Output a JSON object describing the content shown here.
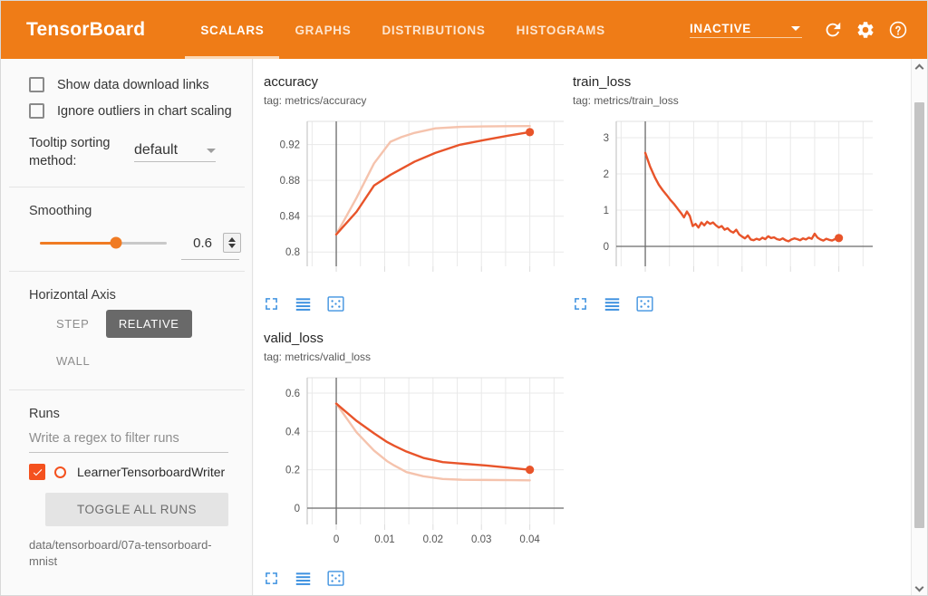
{
  "header": {
    "brand": "TensorBoard",
    "tabs": [
      {
        "label": "SCALARS",
        "active": true
      },
      {
        "label": "GRAPHS",
        "active": false
      },
      {
        "label": "DISTRIBUTIONS",
        "active": false
      },
      {
        "label": "HISTOGRAMS",
        "active": false
      }
    ],
    "status": "INACTIVE",
    "icons": [
      "reload-icon",
      "gear-icon",
      "help-icon"
    ],
    "accent_color": "#ef7c17"
  },
  "sidebar": {
    "checkboxes": [
      {
        "label": "Show data download links",
        "checked": false
      },
      {
        "label": "Ignore outliers in chart scaling",
        "checked": false
      }
    ],
    "tooltip_sorting": {
      "label": "Tooltip sorting method:",
      "value": "default"
    },
    "smoothing": {
      "title": "Smoothing",
      "value": "0.6",
      "fraction": 0.6
    },
    "horizontal_axis": {
      "title": "Horizontal Axis",
      "options": [
        {
          "label": "STEP",
          "selected": false
        },
        {
          "label": "RELATIVE",
          "selected": true
        },
        {
          "label": "WALL",
          "selected": false
        }
      ]
    },
    "runs": {
      "title": "Runs",
      "filter_placeholder": "Write a regex to filter runs",
      "items": [
        {
          "name": "LearnerTensorboardWriter",
          "checked": true,
          "color": "#f4511e"
        }
      ],
      "toggle_all_label": "TOGGLE ALL RUNS",
      "path": "data/tensorboard/07a-tensorboard-mnist"
    }
  },
  "charts": [
    {
      "title": "accuracy",
      "tag": "tag: metrics/accuracy",
      "toolbar": [
        "fullscreen-icon",
        "data-table-icon",
        "reset-zoom-icon"
      ]
    },
    {
      "title": "train_loss",
      "tag": "tag: metrics/train_loss",
      "toolbar": [
        "fullscreen-icon",
        "data-table-icon",
        "reset-zoom-icon"
      ]
    },
    {
      "title": "valid_loss",
      "tag": "tag: metrics/valid_loss",
      "toolbar": [
        "fullscreen-icon",
        "data-table-icon",
        "reset-zoom-icon"
      ]
    }
  ],
  "chart_data": [
    {
      "type": "line",
      "title": "accuracy",
      "tag": "metrics/accuracy",
      "xlabel": "",
      "ylabel": "",
      "xlim": [
        -0.006,
        0.047
      ],
      "ylim": [
        0.784,
        0.946
      ],
      "yticks": [
        0.8,
        0.84,
        0.88,
        0.92
      ],
      "ytick_labels": [
        "0.8",
        "0.84",
        "0.88",
        "0.92"
      ],
      "xticks": [
        0,
        0.01,
        0.02,
        0.03,
        0.04
      ],
      "xtick_labels": [
        "",
        "",
        "",
        "",
        ""
      ],
      "grid": true,
      "legend": "none",
      "series": [
        {
          "name": "LearnerTensorboardWriter (raw)",
          "color": "#f5c3ad",
          "x": [
            0,
            0.0042,
            0.0078,
            0.0112,
            0.0135,
            0.0162,
            0.0205,
            0.0255,
            0.0305,
            0.0355,
            0.04
          ],
          "y": [
            0.8196,
            0.8606,
            0.899,
            0.9232,
            0.9285,
            0.9332,
            0.9382,
            0.9398,
            0.9404,
            0.9406,
            0.9407
          ]
        },
        {
          "name": "LearnerTensorboardWriter (smoothed)",
          "color": "#e8542a",
          "x": [
            0,
            0.0042,
            0.0078,
            0.0112,
            0.0135,
            0.0162,
            0.0205,
            0.0255,
            0.0305,
            0.0355,
            0.04
          ],
          "y": [
            0.8196,
            0.845,
            0.8742,
            0.8862,
            0.893,
            0.901,
            0.9108,
            0.9198,
            0.925,
            0.93,
            0.934
          ]
        }
      ],
      "last_point": {
        "x": 0.04,
        "y": 0.934,
        "color": "#e8542a",
        "marker": "circle"
      }
    },
    {
      "type": "line",
      "title": "train_loss",
      "tag": "metrics/train_loss",
      "xlabel": "",
      "ylabel": "",
      "xlim": [
        -0.006,
        0.047
      ],
      "ylim": [
        -0.55,
        3.45
      ],
      "yticks": [
        0,
        1,
        2,
        3
      ],
      "ytick_labels": [
        "0",
        "1",
        "2",
        "3"
      ],
      "xticks": [
        0,
        0.01,
        0.02,
        0.03,
        0.04
      ],
      "xtick_labels": [
        "",
        "",
        "",
        "",
        ""
      ],
      "grid": true,
      "legend": "none",
      "series": [
        {
          "name": "LearnerTensorboardWriter (smoothed)",
          "color": "#e8542a",
          "x": [
            0.0,
            0.001,
            0.002,
            0.0028,
            0.0036,
            0.0044,
            0.0052,
            0.006,
            0.0068,
            0.0074,
            0.008,
            0.0086,
            0.0092,
            0.0098,
            0.0104,
            0.011,
            0.0116,
            0.0122,
            0.0128,
            0.0134,
            0.014,
            0.0146,
            0.0152,
            0.0158,
            0.0164,
            0.017,
            0.0176,
            0.0182,
            0.0188,
            0.0194,
            0.02,
            0.0206,
            0.0212,
            0.0218,
            0.0224,
            0.023,
            0.0236,
            0.0242,
            0.0248,
            0.0254,
            0.026,
            0.0266,
            0.0272,
            0.0278,
            0.0284,
            0.029,
            0.0296,
            0.0302,
            0.0308,
            0.0314,
            0.032,
            0.0326,
            0.0332,
            0.0338,
            0.0344,
            0.035,
            0.0356,
            0.0362,
            0.0368,
            0.0374,
            0.038,
            0.0386,
            0.0392,
            0.0398,
            0.04
          ],
          "y": [
            2.58,
            2.2,
            1.9,
            1.7,
            1.55,
            1.42,
            1.28,
            1.16,
            1.02,
            0.92,
            0.8,
            0.96,
            0.84,
            0.56,
            0.62,
            0.52,
            0.66,
            0.58,
            0.68,
            0.62,
            0.66,
            0.58,
            0.52,
            0.56,
            0.46,
            0.5,
            0.42,
            0.38,
            0.46,
            0.33,
            0.27,
            0.22,
            0.3,
            0.19,
            0.17,
            0.21,
            0.18,
            0.24,
            0.2,
            0.28,
            0.23,
            0.25,
            0.2,
            0.18,
            0.22,
            0.17,
            0.14,
            0.19,
            0.22,
            0.2,
            0.17,
            0.22,
            0.19,
            0.24,
            0.21,
            0.35,
            0.24,
            0.19,
            0.16,
            0.21,
            0.18,
            0.16,
            0.2,
            0.22,
            0.23
          ]
        }
      ],
      "last_point": {
        "x": 0.04,
        "y": 0.23,
        "color": "#e8542a",
        "marker": "circle"
      }
    },
    {
      "type": "line",
      "title": "valid_loss",
      "tag": "metrics/valid_loss",
      "xlabel": "",
      "ylabel": "",
      "xlim": [
        -0.006,
        0.047
      ],
      "ylim": [
        -0.085,
        0.68
      ],
      "yticks": [
        0,
        0.2,
        0.4,
        0.6
      ],
      "ytick_labels": [
        "0",
        "0.2",
        "0.4",
        "0.6"
      ],
      "xticks": [
        0,
        0.01,
        0.02,
        0.03,
        0.04
      ],
      "xtick_labels": [
        "0",
        "0.01",
        "0.02",
        "0.03",
        "0.04"
      ],
      "grid": true,
      "legend": "none",
      "series": [
        {
          "name": "LearnerTensorboardWriter (raw)",
          "color": "#f5c3ad",
          "x": [
            0,
            0.0042,
            0.0078,
            0.0105,
            0.012,
            0.0145,
            0.018,
            0.022,
            0.026,
            0.031,
            0.036,
            0.04
          ],
          "y": [
            0.545,
            0.395,
            0.3,
            0.245,
            0.222,
            0.188,
            0.166,
            0.152,
            0.148,
            0.147,
            0.146,
            0.145
          ]
        },
        {
          "name": "LearnerTensorboardWriter (smoothed)",
          "color": "#e8542a",
          "x": [
            0,
            0.0042,
            0.0078,
            0.0105,
            0.012,
            0.0145,
            0.018,
            0.022,
            0.026,
            0.031,
            0.036,
            0.04
          ],
          "y": [
            0.545,
            0.455,
            0.39,
            0.345,
            0.325,
            0.295,
            0.262,
            0.24,
            0.232,
            0.222,
            0.21,
            0.2
          ]
        }
      ],
      "last_point": {
        "x": 0.04,
        "y": 0.2,
        "color": "#e8542a",
        "marker": "circle"
      }
    }
  ],
  "scrollbar": {
    "up": "chevron-up-icon",
    "down": "chevron-down-icon"
  }
}
